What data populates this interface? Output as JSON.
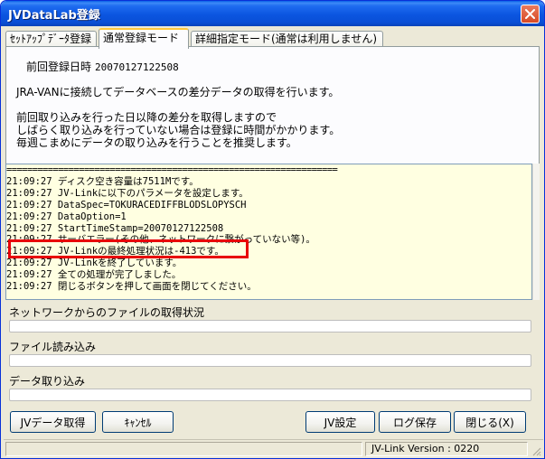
{
  "window": {
    "title": "JVDataLab登録"
  },
  "tabs": [
    {
      "label": "ｾｯﾄｱｯﾌﾟﾃﾞｰﾀ登録",
      "active": false
    },
    {
      "label": "通常登録モード",
      "active": true
    },
    {
      "label": "詳細指定モード(通常は利用しません)",
      "active": false
    }
  ],
  "panel": {
    "last_registration_label": "前回登録日時",
    "last_registration_value": "20070127122508",
    "desc_line1": "JRA-VANに接続してデータベースの差分データの取得を行います。",
    "desc_line2": "前回取り込みを行った日以降の差分を取得しますので",
    "desc_line3": "しばらく取り込みを行っていない場合は登録に時間がかかります。",
    "desc_line4": "毎週こまめにデータの取り込みを行うことを推奨します。"
  },
  "log": {
    "separator": "================================================================",
    "lines": [
      "21:09:27 ディスク空き容量は7511Mです。",
      "21:09:27 JV-Linkに以下のパラメータを設定します。",
      "21:09:27 DataSpec=TOKURACEDIFFBLODSLOPYSCH",
      "21:09:27 DataOption=1",
      "21:09:27 StartTimeStamp=20070127122508",
      "21:09:27 サーバエラー(その他、ネットワークに繋がっていない等)。",
      "21:09:27 JV-Linkの最終処理状況は-413です。",
      "21:09:27 JV-Linkを終了しています。",
      "21:09:27 全ての処理が完了しました。",
      "21:09:27 閉じるボタンを押して画面を閉じてください。"
    ]
  },
  "progress": {
    "network_label": "ネットワークからのファイルの取得状況",
    "network_value": 0,
    "file_read_label": "ファイル読み込み",
    "file_read_value": 0,
    "import_label": "データ取り込み",
    "import_value": 0
  },
  "buttons": {
    "jv_data_get": "JVデータ取得",
    "cancel": "ｷｬﾝｾﾙ",
    "jv_settings": "JV設定",
    "save_log": "ログ保存",
    "close": "閉じる(X)"
  },
  "status": {
    "version": "JV-Link Version : 0220"
  },
  "colors": {
    "titlebar": "#0a55e0",
    "log_background": "#ffffe1",
    "highlight": "#e8000a",
    "active_tab_accent": "#ffc83c"
  }
}
